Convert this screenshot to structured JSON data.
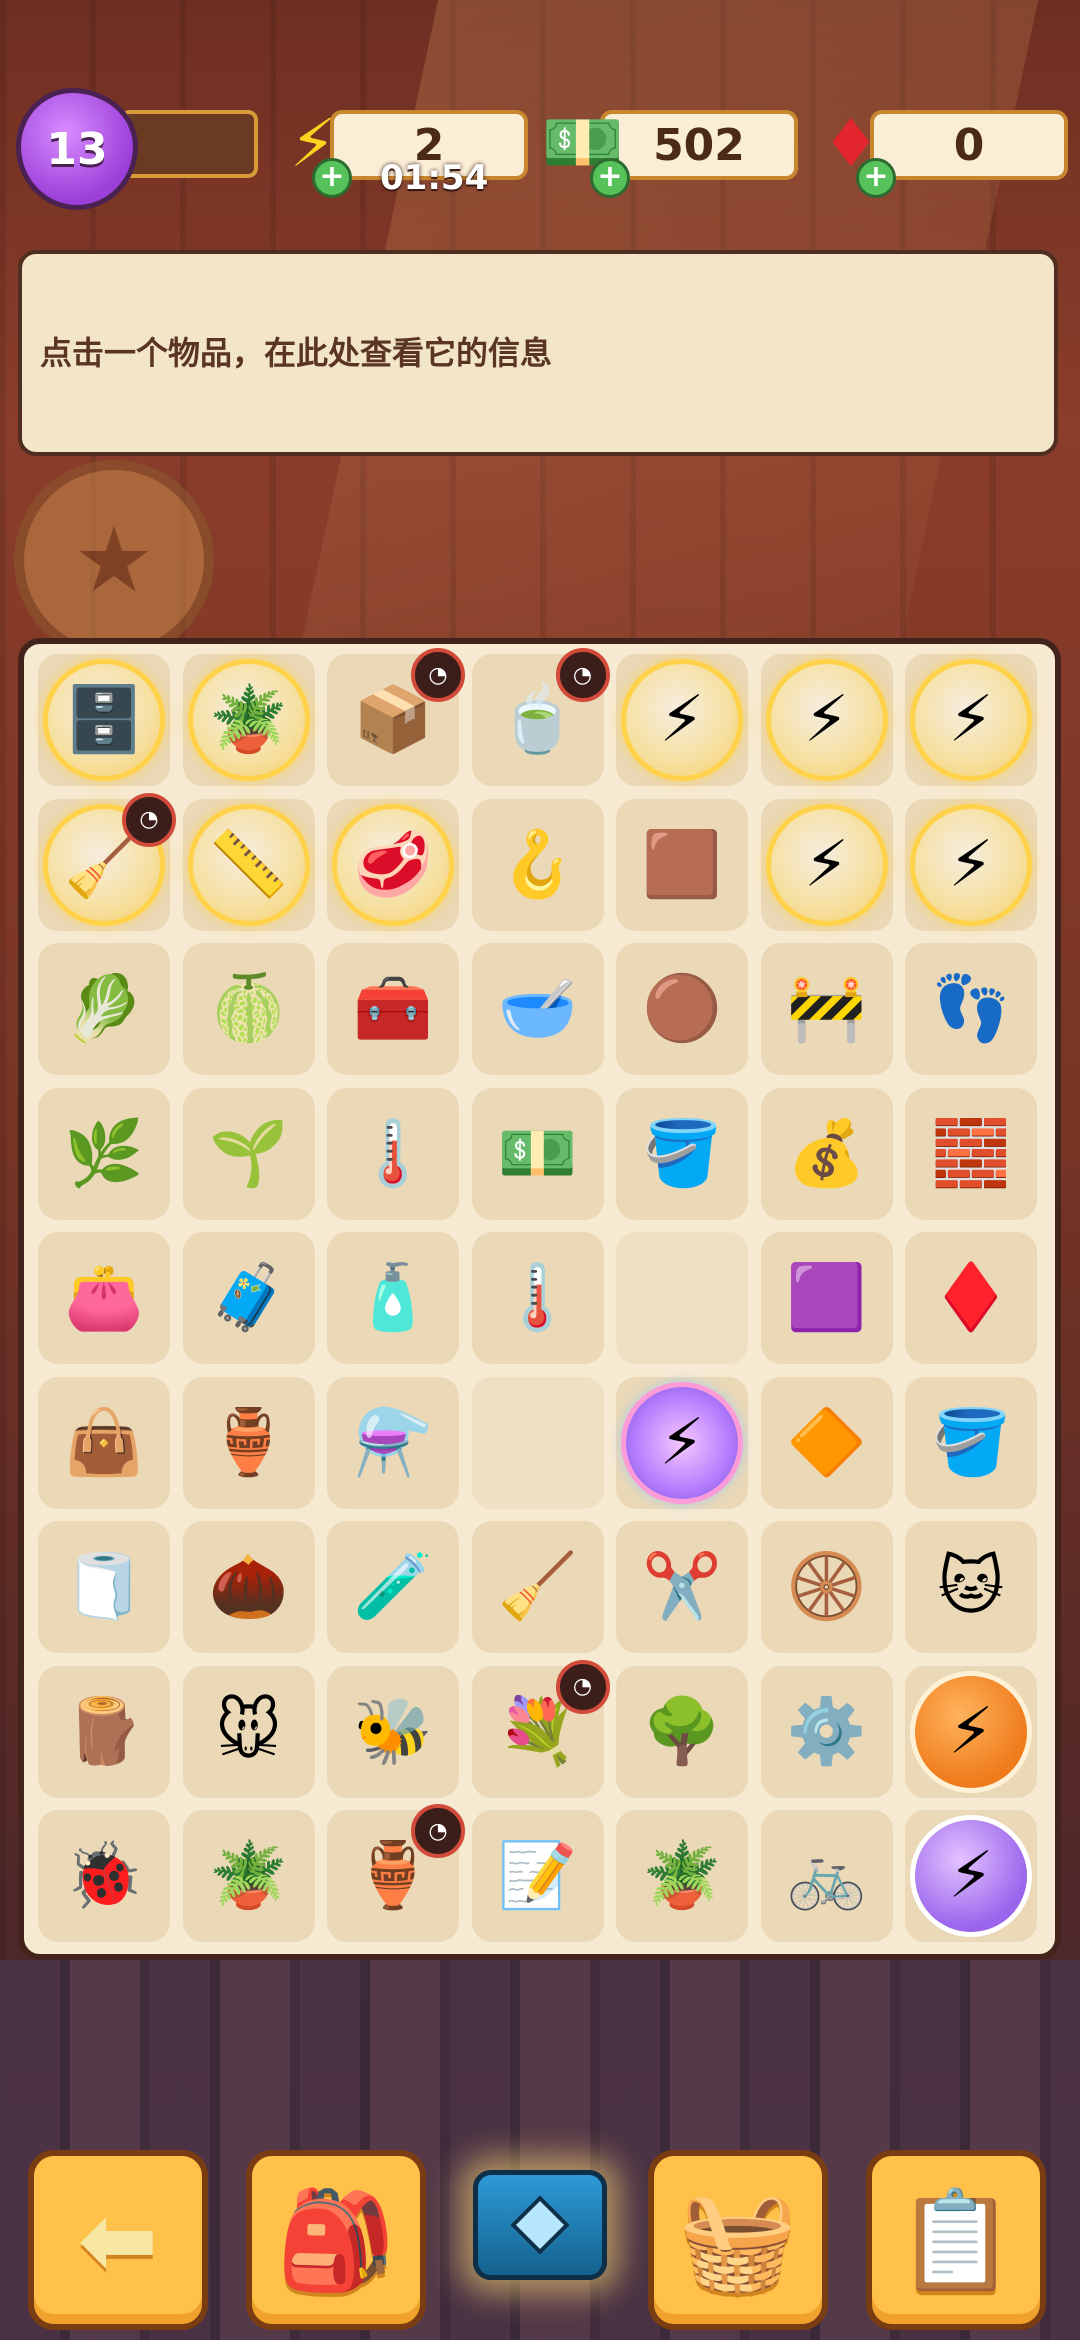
{
  "top_bar": {
    "level": "13",
    "energy": {
      "value": "2",
      "timer": "01:54",
      "icon": "lightning-bolt"
    },
    "cash": {
      "value": "502",
      "icon": "cash-stack"
    },
    "gems": {
      "value": "0",
      "icon": "red-gem"
    }
  },
  "info_panel": {
    "text": "点击一个物品，在此处查看它的信息"
  },
  "board": {
    "rows": [
      [
        {
          "name": "locked-cabinet-item",
          "glyph": "🗄️",
          "state": "locked"
        },
        {
          "name": "locked-terrarium-item",
          "glyph": "🪴",
          "state": "locked"
        },
        {
          "name": "pottery-box-item",
          "glyph": "📦",
          "timer": true
        },
        {
          "name": "cups-box-item",
          "glyph": "🍵",
          "timer": true
        },
        {
          "name": "locked-energy-item",
          "glyph": "⚡",
          "state": "locked"
        },
        {
          "name": "locked-energy-item",
          "glyph": "⚡",
          "state": "locked"
        },
        {
          "name": "locked-energy-item",
          "glyph": "⚡",
          "state": "locked"
        }
      ],
      [
        {
          "name": "locked-broom-item",
          "glyph": "🧹",
          "state": "locked",
          "timer": true
        },
        {
          "name": "locked-tape-item",
          "glyph": "📏",
          "state": "locked"
        },
        {
          "name": "locked-meat-item",
          "glyph": "🥩",
          "state": "locked"
        },
        {
          "name": "hook-item",
          "glyph": "🪝"
        },
        {
          "name": "mud-stain-item",
          "glyph": "🟫"
        },
        {
          "name": "locked-energy-item",
          "glyph": "⚡",
          "state": "locked"
        },
        {
          "name": "locked-energy-item",
          "glyph": "⚡",
          "state": "locked"
        }
      ],
      [
        {
          "name": "big-plant-item",
          "glyph": "🥬"
        },
        {
          "name": "melon-item",
          "glyph": "🍈"
        },
        {
          "name": "first-aid-kit-item",
          "glyph": "🧰"
        },
        {
          "name": "pet-bowl-item",
          "glyph": "🥣"
        },
        {
          "name": "mud-stains-item",
          "glyph": "🟤"
        },
        {
          "name": "caution-sign-item",
          "glyph": "🚧"
        },
        {
          "name": "footprint-box-item",
          "glyph": "👣"
        }
      ],
      [
        {
          "name": "leafy-plant-item",
          "glyph": "🌿"
        },
        {
          "name": "sprout-item",
          "glyph": "🌱"
        },
        {
          "name": "thermometer-item",
          "glyph": "🌡️"
        },
        {
          "name": "cash-item",
          "glyph": "💵"
        },
        {
          "name": "dirty-tray-item",
          "glyph": "🪣"
        },
        {
          "name": "seed-bag-item",
          "glyph": "💰"
        },
        {
          "name": "blocks-item",
          "glyph": "🧱"
        }
      ],
      [
        {
          "name": "wallet-item",
          "glyph": "👛"
        },
        {
          "name": "toolbox-item",
          "glyph": "🧳"
        },
        {
          "name": "medicine-jar-item",
          "glyph": "🧴"
        },
        {
          "name": "glass-thermometer-item",
          "glyph": "🌡️"
        },
        {
          "name": "empty-cell",
          "glyph": ""
        },
        {
          "name": "purple-gem-item",
          "glyph": "🟪"
        },
        {
          "name": "red-gem-item",
          "glyph": "♦️"
        }
      ],
      [
        {
          "name": "wallets-stack-item",
          "glyph": "👜"
        },
        {
          "name": "sand-bottle-item",
          "glyph": "🏺"
        },
        {
          "name": "medicine-bottles-item",
          "glyph": "⚗️"
        },
        {
          "name": "empty-cell",
          "glyph": ""
        },
        {
          "name": "rainbow-energy-item",
          "glyph": "⚡",
          "state": "rainbow"
        },
        {
          "name": "orange-gem-item",
          "glyph": "🔶"
        },
        {
          "name": "gem-bucket-item",
          "glyph": "🪣"
        }
      ],
      [
        {
          "name": "tape-roll-item",
          "glyph": "🧻"
        },
        {
          "name": "seeds-item",
          "glyph": "🌰"
        },
        {
          "name": "green-slime-item",
          "glyph": "🧪"
        },
        {
          "name": "broom-item",
          "glyph": "🧹"
        },
        {
          "name": "pruning-shears-item",
          "glyph": "✂️"
        },
        {
          "name": "wheel-item",
          "glyph": "🛞"
        },
        {
          "name": "lucky-cat-item",
          "glyph": "🐱"
        }
      ],
      [
        {
          "name": "grinding-wheel-item",
          "glyph": "🪵"
        },
        {
          "name": "mouse-figure-item",
          "glyph": "🐭"
        },
        {
          "name": "bee-item",
          "glyph": "🐝"
        },
        {
          "name": "flower-bed-item",
          "glyph": "💐",
          "timer": true
        },
        {
          "name": "bush-item",
          "glyph": "🌳"
        },
        {
          "name": "wheels-item",
          "glyph": "⚙️"
        },
        {
          "name": "orange-energy-item",
          "glyph": "⚡",
          "state": "orange-orb"
        }
      ],
      [
        {
          "name": "ladybug-item",
          "glyph": "🐞"
        },
        {
          "name": "cracked-pot-item",
          "glyph": "🪴"
        },
        {
          "name": "vase-item",
          "glyph": "🏺",
          "timer": true
        },
        {
          "name": "test-papers-item",
          "glyph": "📝"
        },
        {
          "name": "potted-plant-item",
          "glyph": "🪴"
        },
        {
          "name": "bicycle-item",
          "glyph": "🚲"
        },
        {
          "name": "purple-energy-item",
          "glyph": "⚡",
          "state": "purple-orb"
        }
      ]
    ]
  },
  "bottom_nav": [
    {
      "name": "back-button",
      "glyph": "⬅"
    },
    {
      "name": "backpack-button",
      "glyph": "🎒"
    },
    {
      "name": "chest-button",
      "glyph": ""
    },
    {
      "name": "basket-button",
      "glyph": "🧺"
    },
    {
      "name": "tasks-button",
      "glyph": "📋"
    }
  ]
}
